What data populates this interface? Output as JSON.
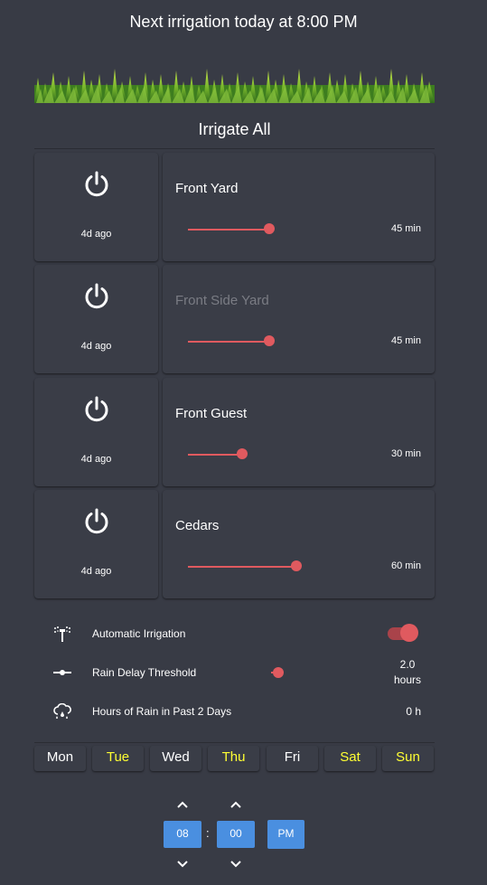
{
  "header": {
    "next_irrigation": "Next irrigation today at 8:00 PM"
  },
  "irrigate_all": {
    "label": "Irrigate All"
  },
  "zones": [
    {
      "name": "Front Yard",
      "last_run": "4d ago",
      "duration": "45 min",
      "level": 0.45,
      "enabled": true
    },
    {
      "name": "Front Side Yard",
      "last_run": "4d ago",
      "duration": "45 min",
      "level": 0.45,
      "enabled": false
    },
    {
      "name": "Front Guest",
      "last_run": "4d ago",
      "duration": "30 min",
      "level": 0.3,
      "enabled": true
    },
    {
      "name": "Cedars",
      "last_run": "4d ago",
      "duration": "60 min",
      "level": 0.6,
      "enabled": true
    }
  ],
  "settings": {
    "automatic": {
      "label": "Automatic Irrigation",
      "icon": "sprinkler-icon",
      "on": true
    },
    "rain_delay": {
      "label": "Rain Delay Threshold",
      "icon": "slider-dots-icon",
      "value_line1": "2.0",
      "value_line2": "hours"
    },
    "rain_hours": {
      "label": "Hours of Rain in Past 2 Days",
      "icon": "cloud-rain-icon",
      "value": "0 h"
    }
  },
  "days": [
    {
      "label": "Mon",
      "active": false
    },
    {
      "label": "Tue",
      "active": true
    },
    {
      "label": "Wed",
      "active": false
    },
    {
      "label": "Thu",
      "active": true
    },
    {
      "label": "Fri",
      "active": false
    },
    {
      "label": "Sat",
      "active": true
    },
    {
      "label": "Sun",
      "active": true
    }
  ],
  "time": {
    "hour": "08",
    "separator": ":",
    "minute": "00",
    "ampm": "PM"
  },
  "colors": {
    "background": "#383b45",
    "accent": "#e05a5f",
    "active_day": "#ffff33",
    "time_box": "#4a8fe0"
  }
}
